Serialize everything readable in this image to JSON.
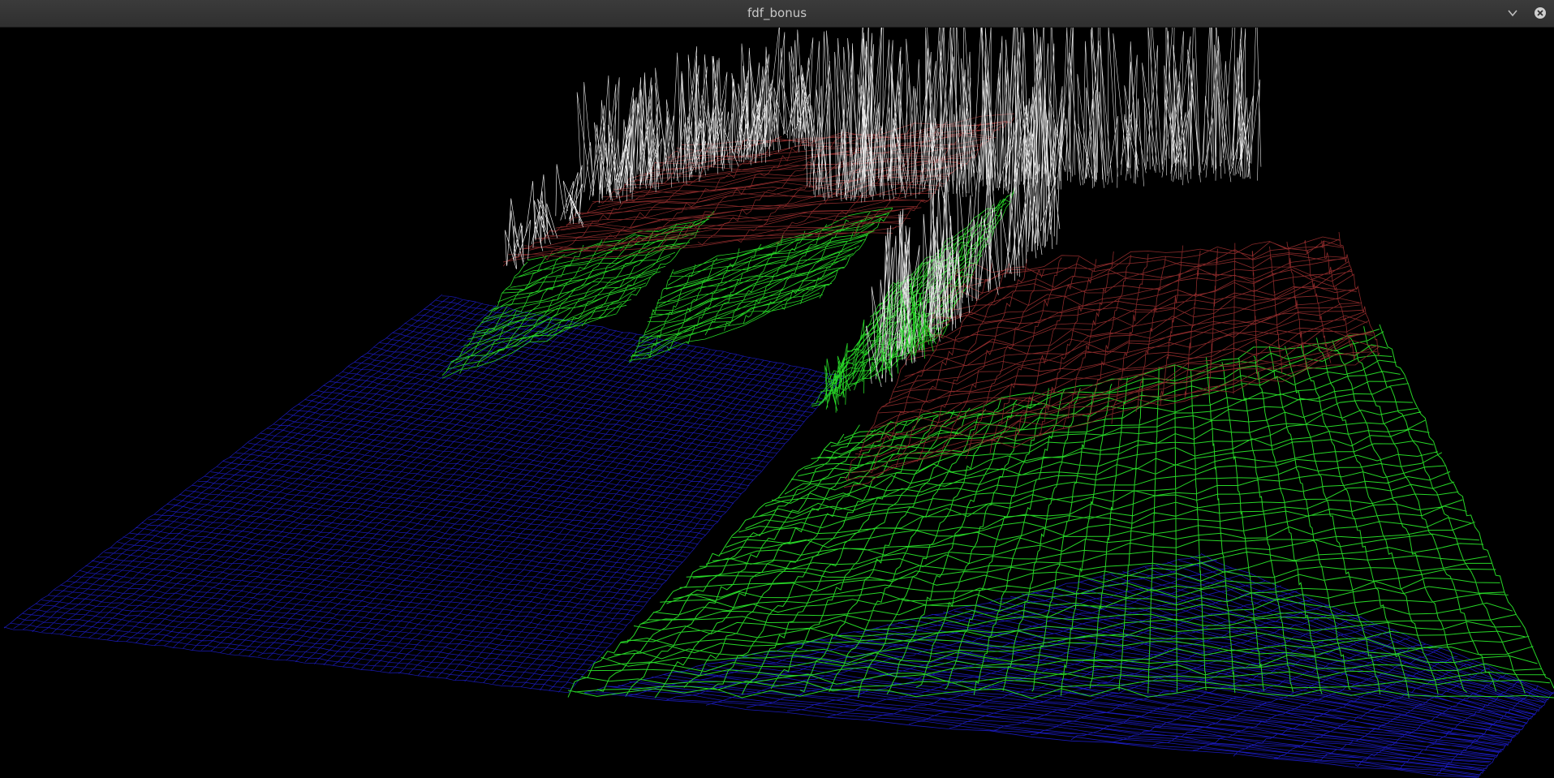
{
  "window": {
    "title": "fdf_bonus",
    "buttons": {
      "minimize_icon": "chevron-down-icon",
      "close_icon": "close-circle-icon"
    }
  },
  "render": {
    "type": "wireframe-heightmap",
    "background": "#000000",
    "palette": {
      "low": "#1a1ab8",
      "mid": "#27d627",
      "high": "#8a2a2a",
      "peak": "#e6e6e6"
    }
  }
}
